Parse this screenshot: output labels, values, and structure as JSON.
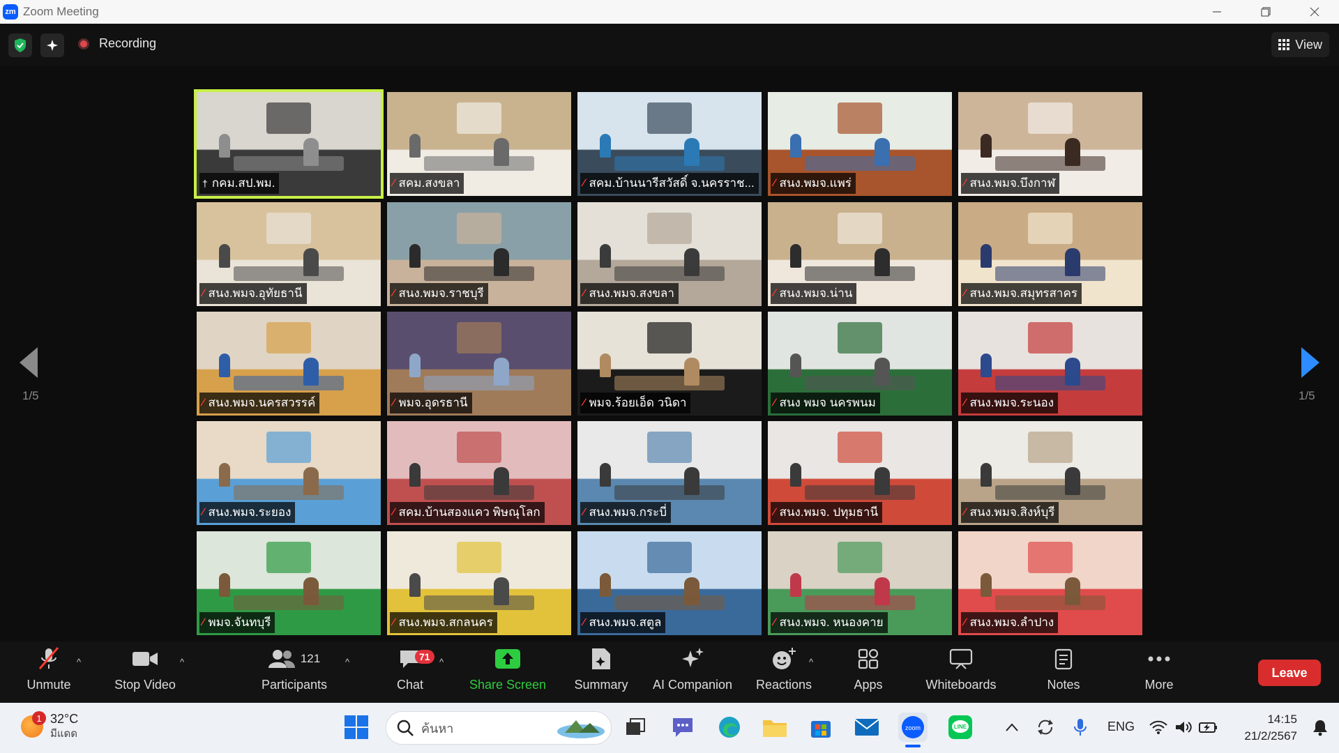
{
  "window": {
    "title": "Zoom Meeting"
  },
  "top_bar": {
    "recording_label": "Recording",
    "view_label": "View"
  },
  "gallery": {
    "page_label_left": "1/5",
    "page_label_right": "1/5",
    "tiles": [
      {
        "name": "กคม.สป.พม.",
        "muted": false,
        "active": true
      },
      {
        "name": "สคม.สงขลา",
        "muted": true
      },
      {
        "name": "สคม.บ้านนารีสวัสดิ์ จ.นครราช...",
        "muted": true
      },
      {
        "name": "สนง.พมจ.แพร่",
        "muted": true
      },
      {
        "name": "สนง.พมจ.บึงกาฬ",
        "muted": true
      },
      {
        "name": "สนง.พมจ.อุทัยธานี",
        "muted": true
      },
      {
        "name": "สนง.พมจ.ราชบุรี",
        "muted": true
      },
      {
        "name": "สนง.พมจ.สงขลา",
        "muted": true
      },
      {
        "name": "สนง.พมจ.น่าน",
        "muted": true
      },
      {
        "name": "สนง.พมจ.สมุทรสาคร",
        "muted": true
      },
      {
        "name": "สนง.พมจ.นครสวรรค์",
        "muted": true
      },
      {
        "name": "พมจ.อุดรธานี",
        "muted": true
      },
      {
        "name": "พมจ.ร้อยเอ็ด วนิดา",
        "muted": true
      },
      {
        "name": "สนง พมจ นครพนม",
        "muted": true
      },
      {
        "name": "สนง.พมจ.ระนอง",
        "muted": true
      },
      {
        "name": "สนง.พมจ.ระยอง",
        "muted": true
      },
      {
        "name": "สคม.บ้านสองแคว พิษณุโลก",
        "muted": true
      },
      {
        "name": "สนง.พมจ.กระบี่",
        "muted": true
      },
      {
        "name": "สนง.พมจ. ปทุมธานี",
        "muted": true
      },
      {
        "name": "สนง.พมจ.สิงห์บุรี",
        "muted": true
      },
      {
        "name": "พมจ.จันทบุรี",
        "muted": true
      },
      {
        "name": "สนง.พมจ.สกลนคร",
        "muted": true
      },
      {
        "name": "สนง.พมจ.สตูล",
        "muted": true
      },
      {
        "name": "สนง.พมจ. หนองคาย",
        "muted": true
      },
      {
        "name": "สนง.พมจ.ลำปาง",
        "muted": true
      }
    ]
  },
  "toolbar": {
    "unmute": "Unmute",
    "stop_video": "Stop Video",
    "participants": "Participants",
    "participants_count": "121",
    "chat": "Chat",
    "chat_badge": "71",
    "share_screen": "Share Screen",
    "summary": "Summary",
    "ai_companion": "AI Companion",
    "reactions": "Reactions",
    "apps": "Apps",
    "whiteboards": "Whiteboards",
    "notes": "Notes",
    "more": "More",
    "leave": "Leave",
    "share_color": "#2ecc40",
    "leave_color": "#d92d2d"
  },
  "taskbar": {
    "weather_temp": "32°C",
    "weather_desc": "มีแดด",
    "weather_badge": "1",
    "search_placeholder": "ค้นหา",
    "language": "ENG",
    "time": "14:15",
    "date": "21/2/2567"
  }
}
